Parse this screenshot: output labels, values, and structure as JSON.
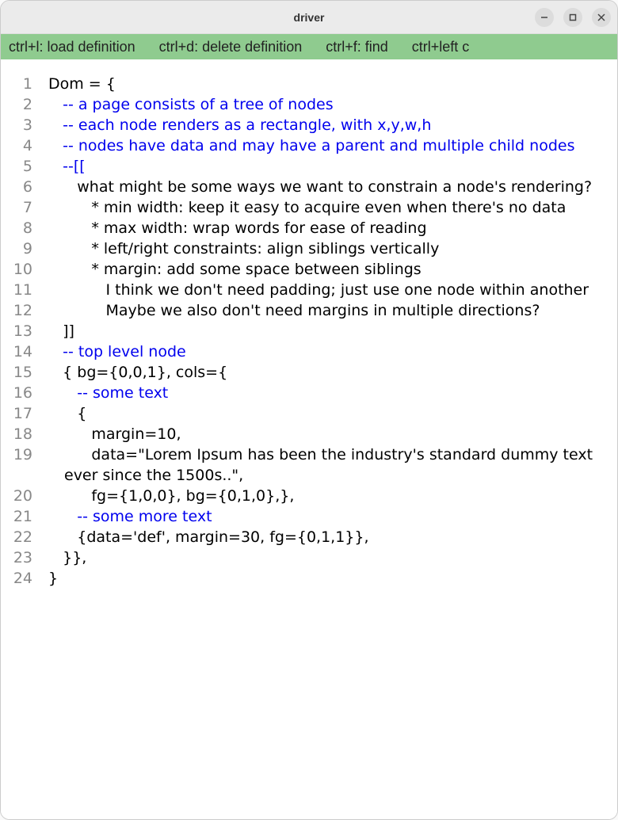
{
  "window": {
    "title": "driver"
  },
  "toolbar": {
    "items": [
      "ctrl+l: load definition",
      "ctrl+d: delete definition",
      "ctrl+f: find",
      "ctrl+left c"
    ]
  },
  "colors": {
    "toolbar_bg": "#8fcb8f",
    "comment": "#0000ee",
    "gutter": "#888888"
  },
  "code": {
    "lines": [
      {
        "n": 1,
        "indent": 0,
        "segments": [
          {
            "t": "Dom = {",
            "c": false
          }
        ]
      },
      {
        "n": 2,
        "indent": 1,
        "segments": [
          {
            "t": "-- a page consists of a tree of nodes",
            "c": true
          }
        ]
      },
      {
        "n": 3,
        "indent": 1,
        "segments": [
          {
            "t": "-- each node renders as a rectangle, with x,y,w,h",
            "c": true
          }
        ]
      },
      {
        "n": 4,
        "indent": 1,
        "segments": [
          {
            "t": "-- nodes have data and may have a parent and multiple child nodes",
            "c": true
          }
        ]
      },
      {
        "n": 5,
        "indent": 1,
        "segments": [
          {
            "t": "--[[",
            "c": true
          }
        ]
      },
      {
        "n": 6,
        "indent": 2,
        "segments": [
          {
            "t": "what might be some ways we want to constrain a node's rendering?",
            "c": false
          }
        ]
      },
      {
        "n": 7,
        "indent": 3,
        "segments": [
          {
            "t": "* min width: keep it easy to acquire even when there's no data",
            "c": false
          }
        ]
      },
      {
        "n": 8,
        "indent": 3,
        "segments": [
          {
            "t": "* max width: wrap words for ease of reading",
            "c": false
          }
        ]
      },
      {
        "n": 9,
        "indent": 3,
        "segments": [
          {
            "t": "* left/right constraints: align siblings vertically",
            "c": false
          }
        ]
      },
      {
        "n": 10,
        "indent": 3,
        "segments": [
          {
            "t": "* margin: add some space between siblings",
            "c": false
          }
        ]
      },
      {
        "n": 11,
        "indent": 4,
        "segments": [
          {
            "t": "I think we don't need padding; just use one node within another",
            "c": false
          }
        ]
      },
      {
        "n": 12,
        "indent": 4,
        "segments": [
          {
            "t": "Maybe we also don't need margins in multiple directions?",
            "c": false
          }
        ]
      },
      {
        "n": 13,
        "indent": 1,
        "segments": [
          {
            "t": "]]",
            "c": false
          }
        ]
      },
      {
        "n": 14,
        "indent": 1,
        "segments": [
          {
            "t": "-- top level node",
            "c": true
          }
        ]
      },
      {
        "n": 15,
        "indent": 1,
        "segments": [
          {
            "t": "{ bg={0,0,1}, cols={",
            "c": false
          }
        ]
      },
      {
        "n": 16,
        "indent": 2,
        "segments": [
          {
            "t": "-- some text",
            "c": true
          }
        ]
      },
      {
        "n": 17,
        "indent": 2,
        "segments": [
          {
            "t": "{",
            "c": false
          }
        ]
      },
      {
        "n": 18,
        "indent": 3,
        "segments": [
          {
            "t": "margin=10,",
            "c": false
          }
        ]
      },
      {
        "n": 19,
        "indent": 3,
        "segments": [
          {
            "t": "data=\"Lorem Ipsum has been the industry's standard dummy text ever since the 1500s..\",",
            "c": false
          }
        ]
      },
      {
        "n": 20,
        "indent": 3,
        "segments": [
          {
            "t": "fg={1,0,0}, bg={0,1,0},},",
            "c": false
          }
        ]
      },
      {
        "n": 21,
        "indent": 2,
        "segments": [
          {
            "t": "-- some more text",
            "c": true
          }
        ]
      },
      {
        "n": 22,
        "indent": 2,
        "segments": [
          {
            "t": "{data='def', margin=30, fg={0,1,1}},",
            "c": false
          }
        ]
      },
      {
        "n": 23,
        "indent": 1,
        "segments": [
          {
            "t": "}},",
            "c": false
          }
        ]
      },
      {
        "n": 24,
        "indent": 0,
        "segments": [
          {
            "t": "}",
            "c": false
          }
        ]
      }
    ]
  }
}
